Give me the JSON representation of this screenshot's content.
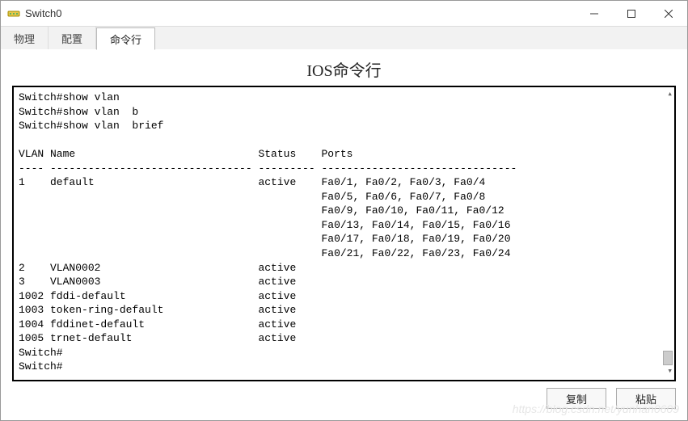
{
  "window": {
    "title": "Switch0"
  },
  "tabs": {
    "physical": "物理",
    "config": "配置",
    "cli": "命令行"
  },
  "cli_title": "IOS命令行",
  "terminal": {
    "lines": [
      "Switch#show vlan",
      "Switch#show vlan  b",
      "Switch#show vlan  brief",
      "",
      "VLAN Name                             Status    Ports",
      "---- -------------------------------- --------- -------------------------------",
      "1    default                          active    Fa0/1, Fa0/2, Fa0/3, Fa0/4",
      "                                                Fa0/5, Fa0/6, Fa0/7, Fa0/8",
      "                                                Fa0/9, Fa0/10, Fa0/11, Fa0/12",
      "                                                Fa0/13, Fa0/14, Fa0/15, Fa0/16",
      "                                                Fa0/17, Fa0/18, Fa0/19, Fa0/20",
      "                                                Fa0/21, Fa0/22, Fa0/23, Fa0/24",
      "2    VLAN0002                         active    ",
      "3    VLAN0003                         active    ",
      "1002 fddi-default                     active    ",
      "1003 token-ring-default               active    ",
      "1004 fddinet-default                  active    ",
      "1005 trnet-default                    active    ",
      "Switch#",
      "Switch#"
    ]
  },
  "vlan_table": {
    "columns": [
      "VLAN",
      "Name",
      "Status",
      "Ports"
    ],
    "rows": [
      {
        "vlan": 1,
        "name": "default",
        "status": "active",
        "ports": [
          "Fa0/1",
          "Fa0/2",
          "Fa0/3",
          "Fa0/4",
          "Fa0/5",
          "Fa0/6",
          "Fa0/7",
          "Fa0/8",
          "Fa0/9",
          "Fa0/10",
          "Fa0/11",
          "Fa0/12",
          "Fa0/13",
          "Fa0/14",
          "Fa0/15",
          "Fa0/16",
          "Fa0/17",
          "Fa0/18",
          "Fa0/19",
          "Fa0/20",
          "Fa0/21",
          "Fa0/22",
          "Fa0/23",
          "Fa0/24"
        ]
      },
      {
        "vlan": 2,
        "name": "VLAN0002",
        "status": "active",
        "ports": []
      },
      {
        "vlan": 3,
        "name": "VLAN0003",
        "status": "active",
        "ports": []
      },
      {
        "vlan": 1002,
        "name": "fddi-default",
        "status": "active",
        "ports": []
      },
      {
        "vlan": 1003,
        "name": "token-ring-default",
        "status": "active",
        "ports": []
      },
      {
        "vlan": 1004,
        "name": "fddinet-default",
        "status": "active",
        "ports": []
      },
      {
        "vlan": 1005,
        "name": "trnet-default",
        "status": "active",
        "ports": []
      }
    ]
  },
  "buttons": {
    "copy": "复制",
    "paste": "粘贴"
  },
  "watermark": "https://blog.csdn.net/yunhan0609"
}
